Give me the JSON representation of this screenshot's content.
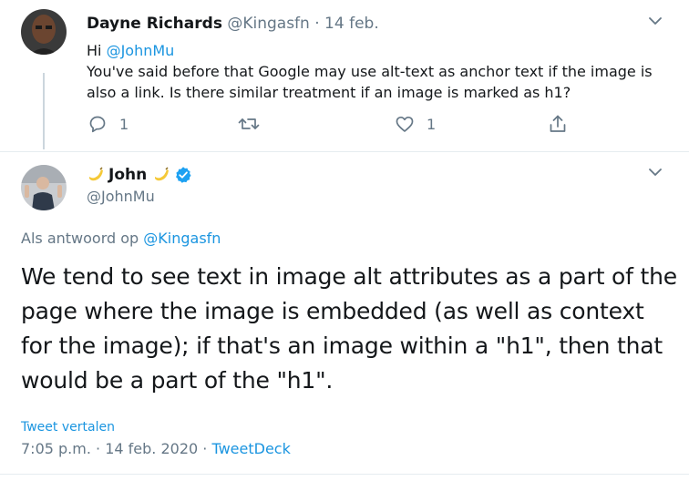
{
  "reply_tweet": {
    "author_name": "Dayne Richards",
    "author_handle": "@Kingasfn",
    "separator": "·",
    "date": "14 feb.",
    "greeting": "Hi",
    "mention": "@JohnMu",
    "text": "You've said before that Google may use alt-text as anchor text if the image is also a link. Is there similar treatment if an image is marked as h1?",
    "actions": {
      "reply_count": "1",
      "like_count": "1"
    }
  },
  "main_tweet": {
    "author_name": "John",
    "author_handle": "@JohnMu",
    "verified": true,
    "reply_to_label": "Als antwoord op",
    "reply_to_handle": "@Kingasfn",
    "text": "We tend to see text in image alt attributes as a part of the page where the image is embedded (as well as context for the image); if that's an image within a \"h1\", then that would be a part of the \"h1\".",
    "translate_label": "Tweet vertalen",
    "time": "7:05 p.m.",
    "separator": "·",
    "date": "14 feb. 2020",
    "separator2": "·",
    "source": "TweetDeck"
  },
  "colors": {
    "link": "#1b95e0",
    "secondary_text": "#657786",
    "primary_text": "#14171a",
    "verified_badge": "#1da1f2"
  },
  "icons": {
    "reply": "reply-icon",
    "retweet": "retweet-icon",
    "like": "heart-icon",
    "share": "share-icon",
    "more": "chevron-down-icon",
    "banana": "banana-emoji-icon",
    "verified": "verified-badge-icon"
  }
}
